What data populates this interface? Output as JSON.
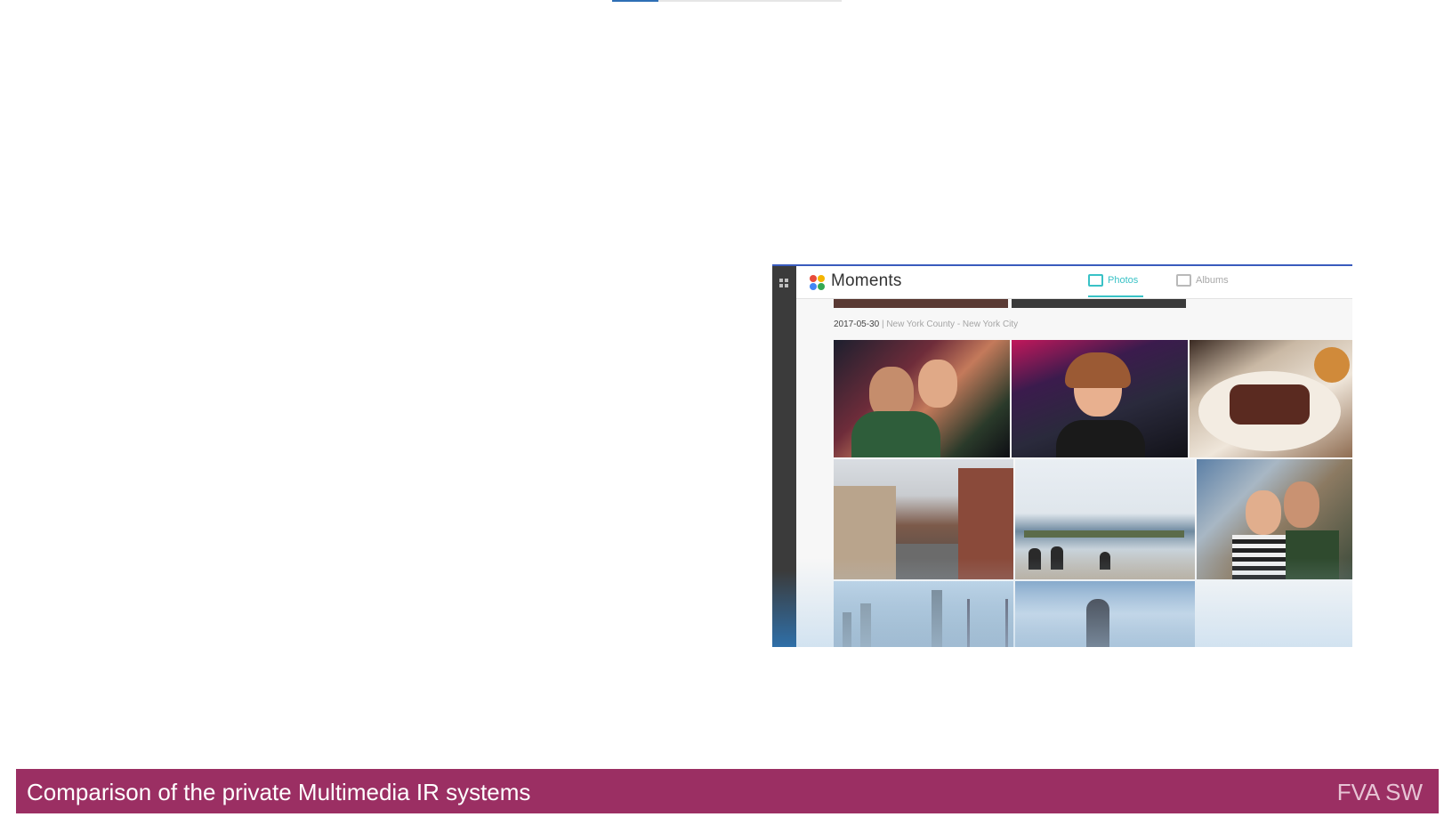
{
  "screenshot": {
    "app_title": "Moments",
    "tabs": [
      {
        "label": "Photos",
        "icon": "photo-icon",
        "active": true
      },
      {
        "label": "Albums",
        "icon": "album-icon",
        "active": false
      }
    ],
    "date": "2017-05-30",
    "location": "New York County - New York City",
    "accent_color": "#39c2c6"
  },
  "footer": {
    "title": "Comparison of the private Multimedia IR systems",
    "right": "FVA SW",
    "background": "#9b2f63"
  }
}
